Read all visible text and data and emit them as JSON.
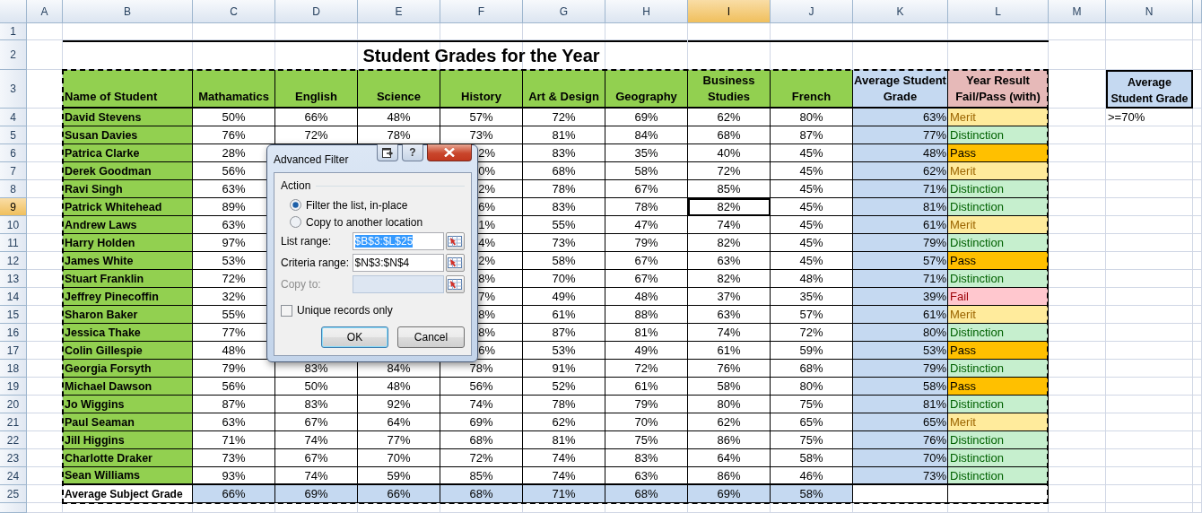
{
  "column_headers": [
    {
      "label": "A",
      "selected": false
    },
    {
      "label": "B",
      "selected": false
    },
    {
      "label": "C",
      "selected": false
    },
    {
      "label": "D",
      "selected": false
    },
    {
      "label": "E",
      "selected": false
    },
    {
      "label": "F",
      "selected": false
    },
    {
      "label": "G",
      "selected": false
    },
    {
      "label": "H",
      "selected": false
    },
    {
      "label": "I",
      "selected": true
    },
    {
      "label": "J",
      "selected": false
    },
    {
      "label": "K",
      "selected": false
    },
    {
      "label": "L",
      "selected": false
    },
    {
      "label": "M",
      "selected": false
    },
    {
      "label": "N",
      "selected": false
    }
  ],
  "row_headers": [
    {
      "label": "1",
      "selected": false
    },
    {
      "label": "2",
      "selected": false
    },
    {
      "label": "3",
      "selected": false
    },
    {
      "label": "4",
      "selected": false
    },
    {
      "label": "5",
      "selected": false
    },
    {
      "label": "6",
      "selected": false
    },
    {
      "label": "7",
      "selected": false
    },
    {
      "label": "8",
      "selected": false
    },
    {
      "label": "9",
      "selected": true
    },
    {
      "label": "10",
      "selected": false
    },
    {
      "label": "11",
      "selected": false
    },
    {
      "label": "12",
      "selected": false
    },
    {
      "label": "13",
      "selected": false
    },
    {
      "label": "14",
      "selected": false
    },
    {
      "label": "15",
      "selected": false
    },
    {
      "label": "16",
      "selected": false
    },
    {
      "label": "17",
      "selected": false
    },
    {
      "label": "18",
      "selected": false
    },
    {
      "label": "19",
      "selected": false
    },
    {
      "label": "20",
      "selected": false
    },
    {
      "label": "21",
      "selected": false
    },
    {
      "label": "22",
      "selected": false
    },
    {
      "label": "23",
      "selected": false
    },
    {
      "label": "24",
      "selected": false
    },
    {
      "label": "25",
      "selected": false
    }
  ],
  "title": "Student Grades for the Year",
  "table": {
    "columns": [
      "Name of Student",
      "Mathamatics",
      "English",
      "Science",
      "History",
      "Art & Design",
      "Geography",
      "Business Studies",
      "French",
      "Average Student Grade",
      "Year Result Fail/Pass (with)"
    ],
    "rows": [
      {
        "name": "David Stevens",
        "scores": [
          "50%",
          "66%",
          "48%",
          "57%",
          "72%",
          "69%",
          "62%",
          "80%"
        ],
        "average": "63%",
        "result": {
          "text": "Merit",
          "kind": "merit"
        }
      },
      {
        "name": "Susan Davies",
        "scores": [
          "76%",
          "72%",
          "78%",
          "73%",
          "81%",
          "84%",
          "68%",
          "87%"
        ],
        "average": "77%",
        "result": {
          "text": "Distinction",
          "kind": "distinction"
        }
      },
      {
        "name": "Patrica Clarke",
        "kind": "covered",
        "scores": [
          "28%",
          "2%",
          "83%",
          "35%",
          "40%",
          "45%"
        ],
        "average": "48%",
        "result": {
          "text": "Pass",
          "kind": "pass"
        }
      },
      {
        "name": "Derek Goodman",
        "kind": "covered",
        "scores": [
          "56%",
          "0%",
          "68%",
          "58%",
          "72%",
          "45%"
        ],
        "average": "62%",
        "result": {
          "text": "Merit",
          "kind": "merit"
        }
      },
      {
        "name": "Ravi Singh",
        "kind": "covered",
        "scores": [
          "63%",
          "2%",
          "78%",
          "67%",
          "85%",
          "45%"
        ],
        "average": "71%",
        "result": {
          "text": "Distinction",
          "kind": "distinction"
        }
      },
      {
        "name": "Patrick Whitehead",
        "kind": "covered",
        "scores": [
          "89%",
          "6%",
          "83%",
          "78%",
          "82%",
          "45%"
        ],
        "average": "81%",
        "result": {
          "text": "Distinction",
          "kind": "distinction"
        }
      },
      {
        "name": "Andrew Laws",
        "kind": "covered",
        "scores": [
          "63%",
          "1%",
          "55%",
          "47%",
          "74%",
          "45%"
        ],
        "average": "61%",
        "result": {
          "text": "Merit",
          "kind": "merit"
        }
      },
      {
        "name": "Harry Holden",
        "kind": "covered",
        "scores": [
          "97%",
          "4%",
          "73%",
          "79%",
          "82%",
          "45%"
        ],
        "average": "79%",
        "result": {
          "text": "Distinction",
          "kind": "distinction"
        }
      },
      {
        "name": "James White",
        "kind": "covered",
        "scores": [
          "53%",
          "2%",
          "58%",
          "67%",
          "63%",
          "45%"
        ],
        "average": "57%",
        "result": {
          "text": "Pass",
          "kind": "pass"
        }
      },
      {
        "name": "Stuart Franklin",
        "kind": "covered",
        "scores": [
          "72%",
          "8%",
          "70%",
          "67%",
          "82%",
          "48%"
        ],
        "average": "71%",
        "result": {
          "text": "Distinction",
          "kind": "distinction"
        }
      },
      {
        "name": "Jeffrey Pinecoffin",
        "kind": "covered",
        "scores": [
          "32%",
          "7%",
          "49%",
          "48%",
          "37%",
          "35%"
        ],
        "average": "39%",
        "result": {
          "text": "Fail",
          "kind": "fail"
        }
      },
      {
        "name": "Sharon Baker",
        "kind": "covered",
        "scores": [
          "55%",
          "8%",
          "61%",
          "88%",
          "63%",
          "57%"
        ],
        "average": "61%",
        "result": {
          "text": "Merit",
          "kind": "merit"
        }
      },
      {
        "name": "Jessica Thake",
        "kind": "covered",
        "scores": [
          "77%",
          "8%",
          "87%",
          "81%",
          "74%",
          "72%"
        ],
        "average": "80%",
        "result": {
          "text": "Distinction",
          "kind": "distinction"
        }
      },
      {
        "name": "Colin Gillespie",
        "kind": "covered",
        "scores": [
          "48%",
          "6%",
          "53%",
          "49%",
          "61%",
          "59%"
        ],
        "average": "53%",
        "result": {
          "text": "Pass",
          "kind": "pass"
        }
      },
      {
        "name": "Georgia Forsyth",
        "scores": [
          "79%",
          "83%",
          "84%",
          "78%",
          "91%",
          "72%",
          "76%",
          "68%"
        ],
        "average": "79%",
        "result": {
          "text": "Distinction",
          "kind": "distinction"
        }
      },
      {
        "name": "Michael Dawson",
        "scores": [
          "56%",
          "50%",
          "48%",
          "56%",
          "52%",
          "61%",
          "58%",
          "80%"
        ],
        "average": "58%",
        "result": {
          "text": "Pass",
          "kind": "pass"
        }
      },
      {
        "name": "Jo Wiggins",
        "scores": [
          "87%",
          "83%",
          "92%",
          "74%",
          "78%",
          "79%",
          "80%",
          "75%"
        ],
        "average": "81%",
        "result": {
          "text": "Distinction",
          "kind": "distinction"
        }
      },
      {
        "name": "Paul Seaman",
        "scores": [
          "63%",
          "67%",
          "64%",
          "69%",
          "62%",
          "70%",
          "62%",
          "65%"
        ],
        "average": "65%",
        "result": {
          "text": "Merit",
          "kind": "merit"
        }
      },
      {
        "name": "Jill Higgins",
        "scores": [
          "71%",
          "74%",
          "77%",
          "68%",
          "81%",
          "75%",
          "86%",
          "75%"
        ],
        "average": "76%",
        "result": {
          "text": "Distinction",
          "kind": "distinction"
        }
      },
      {
        "name": "Charlotte Draker",
        "scores": [
          "73%",
          "67%",
          "70%",
          "72%",
          "74%",
          "83%",
          "64%",
          "58%"
        ],
        "average": "70%",
        "result": {
          "text": "Distinction",
          "kind": "distinction"
        }
      },
      {
        "name": "Sean Williams",
        "scores": [
          "93%",
          "74%",
          "59%",
          "85%",
          "74%",
          "63%",
          "86%",
          "46%"
        ],
        "average": "73%",
        "result": {
          "text": "Distinction",
          "kind": "distinction"
        }
      }
    ],
    "footer": {
      "label": "Average Subject Grade",
      "scores": [
        "66%",
        "69%",
        "66%",
        "68%",
        "71%",
        "68%",
        "69%",
        "58%"
      ]
    }
  },
  "criteria": {
    "heading": "Average Student Grade",
    "value": ">=70%"
  },
  "copy_marquee": true,
  "dialog": {
    "title": "Advanced Filter",
    "help_label": "?",
    "action_group": "Action",
    "action_options": [
      {
        "label": "Filter the list, in-place",
        "selected": true
      },
      {
        "label": "Copy to another location",
        "selected": false
      }
    ],
    "fields": [
      {
        "label": "List range:",
        "value": "$B$3:$L$25",
        "disabled": false,
        "text_selected": true
      },
      {
        "label": "Criteria range:",
        "value": "$N$3:$N$4",
        "disabled": false,
        "text_selected": false
      },
      {
        "label": "Copy to:",
        "disabled": true,
        "text_selected": false
      }
    ],
    "unique_records": {
      "label": "Unique records only",
      "checked": false
    },
    "buttons": [
      {
        "label": "OK",
        "default": true
      },
      {
        "label": "Cancel",
        "default": false
      }
    ]
  }
}
